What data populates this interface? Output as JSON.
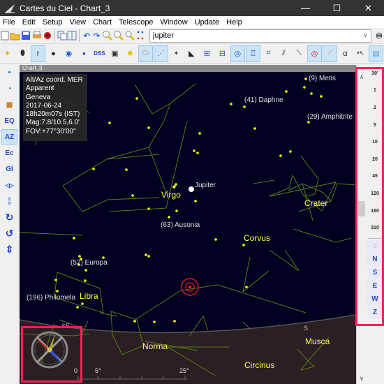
{
  "window": {
    "title": "Cartes du Ciel - Chart_3",
    "buttons": {
      "minimize": "—",
      "maximize": "☐",
      "close": "✕"
    }
  },
  "menu": [
    "File",
    "Edit",
    "Setup",
    "View",
    "Chart",
    "Telescope",
    "Window",
    "Update",
    "Help"
  ],
  "toolbar_main": {
    "buttons": [
      "new-chart",
      "open",
      "save",
      "print",
      "calendar",
      "copy-window",
      "tile-windows",
      "undo",
      "redo",
      "zoom-in",
      "zoom-out",
      "zoom-fov",
      "show-lines"
    ],
    "search_value": "jupiter",
    "find_button": "find-icon"
  },
  "toolbar_objects": {
    "buttons": [
      {
        "name": "stars",
        "active": false
      },
      {
        "name": "nebulae",
        "active": false
      },
      {
        "name": "galaxies-outline",
        "active": true
      },
      {
        "name": "dark-nebula",
        "active": false
      },
      {
        "name": "galaxy",
        "active": false
      },
      {
        "name": "planet-dot",
        "active": false
      },
      {
        "name": "dss",
        "label": "DSS",
        "active": false
      },
      {
        "name": "camera",
        "active": false
      },
      {
        "name": "light-bulb",
        "active": false
      },
      {
        "name": "asteroids",
        "active": true
      },
      {
        "name": "comets",
        "active": true
      },
      {
        "name": "satellite",
        "active": false
      },
      {
        "name": "milky-way",
        "active": false
      },
      {
        "name": "grid-eq",
        "active": false
      },
      {
        "name": "grid-az",
        "active": false
      },
      {
        "name": "compass",
        "active": true
      },
      {
        "name": "constellation-figures",
        "active": true
      },
      {
        "name": "constellation-boundaries",
        "active": false
      },
      {
        "name": "ecliptic",
        "active": false
      },
      {
        "name": "galactic-line",
        "active": false
      },
      {
        "name": "target-circles",
        "active": true
      },
      {
        "name": "ruler",
        "active": true
      },
      {
        "name": "alpha-labels",
        "label": "α",
        "active": false
      },
      {
        "name": "object-labels",
        "active": false
      },
      {
        "name": "horizon-picture",
        "active": true
      }
    ]
  },
  "left_toolbar": [
    {
      "name": "rotate-view",
      "label": ""
    },
    {
      "name": "time-clock",
      "label": ""
    },
    {
      "name": "chart-settings",
      "label": ""
    },
    {
      "name": "eq-mode",
      "label": "EQ"
    },
    {
      "name": "az-mode",
      "label": "AZ",
      "active": true
    },
    {
      "name": "ec-mode",
      "label": "Ec"
    },
    {
      "name": "gl-mode",
      "label": "Gl"
    },
    {
      "name": "flip-horizontal",
      "label": "◁▷"
    },
    {
      "name": "flip-vertical",
      "label": "△▽"
    },
    {
      "name": "rotate-cw",
      "label": "↻"
    },
    {
      "name": "rotate-ccw",
      "label": "↺"
    },
    {
      "name": "flip-updown",
      "label": "⇕"
    }
  ],
  "chart": {
    "window_title": "Chart_3",
    "info": [
      "Alt/Az coord. MER",
      "Apparent",
      "Geneva",
      "2017-06-24",
      "18h20m07s (IST)",
      "Mag:7.8/10.5,6.0'",
      "FOV:+77°30'00\""
    ],
    "labels": {
      "asteroids": [
        "(9) Metis",
        "(41) Daphne",
        "(29) Amphitrite",
        "(63) Ausonia",
        "(52) Europa",
        "(196) Philomela"
      ],
      "planet": "Jupiter",
      "constellations": [
        "Virgo",
        "Crater",
        "Corvus",
        "Libra",
        "Norma",
        "Circinus",
        "Musca"
      ],
      "horizon_directions": [
        "SE",
        "S"
      ],
      "scale_ticks": [
        "0",
        "5°",
        "25°"
      ]
    },
    "colors": {
      "sky": "#000020",
      "ground": "#2a2024",
      "star": "#ffff00",
      "constellation_line": "#5a7a1a",
      "constellation_label": "#ffff40",
      "asteroid_label": "#e0e0e0",
      "target": "#ff2020"
    }
  },
  "right_panel": {
    "fov_buttons": [
      "30'",
      "1",
      "2",
      "5",
      "10",
      "20",
      "45",
      "120",
      "180",
      "310"
    ],
    "direction_buttons": [
      "N",
      "S",
      "E",
      "W",
      "Z"
    ]
  },
  "highlight_color": "#ff1f5a"
}
